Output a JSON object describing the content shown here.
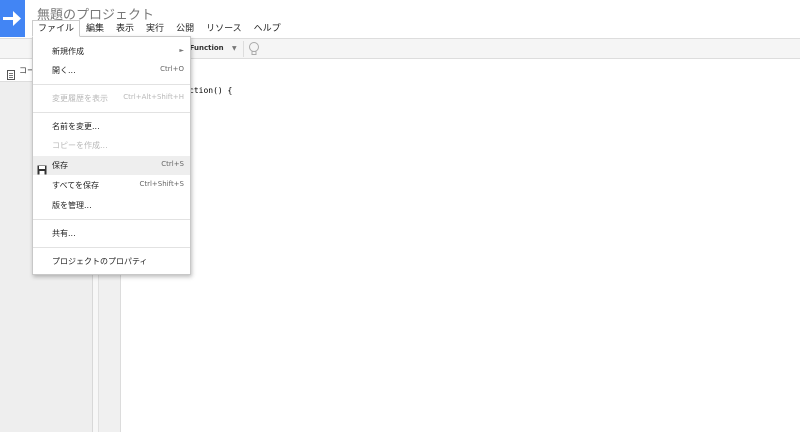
{
  "header": {
    "title": "無題のプロジェクト",
    "accent": "#4285f4"
  },
  "menubar": {
    "items": [
      {
        "label": "ファイル",
        "active": true
      },
      {
        "label": "編集"
      },
      {
        "label": "表示"
      },
      {
        "label": "実行"
      },
      {
        "label": "公開"
      },
      {
        "label": "リソース"
      },
      {
        "label": "ヘルプ"
      }
    ]
  },
  "toolbar": {
    "function_select": "yFunction",
    "caret_icon": "chevron-down-icon",
    "bulb_icon": "lightbulb-icon"
  },
  "sidebar": {
    "file_tab_label": "コー",
    "file_icon": "document-icon"
  },
  "editor": {
    "visible_code": "ction() {"
  },
  "file_menu": {
    "new_label": "新規作成",
    "new_arrow": "►",
    "open_label": "開く...",
    "open_shortcut": "Ctrl+O",
    "history_label": "変更履歴を表示",
    "history_shortcut": "Ctrl+Alt+Shift+H",
    "rename_label": "名前を変更...",
    "copy_label": "コピーを作成...",
    "save_label": "保存",
    "save_shortcut": "Ctrl+S",
    "save_all_label": "すべてを保存",
    "save_all_shortcut": "Ctrl+Shift+S",
    "versions_label": "版を管理...",
    "share_label": "共有...",
    "properties_label": "プロジェクトのプロパティ"
  }
}
